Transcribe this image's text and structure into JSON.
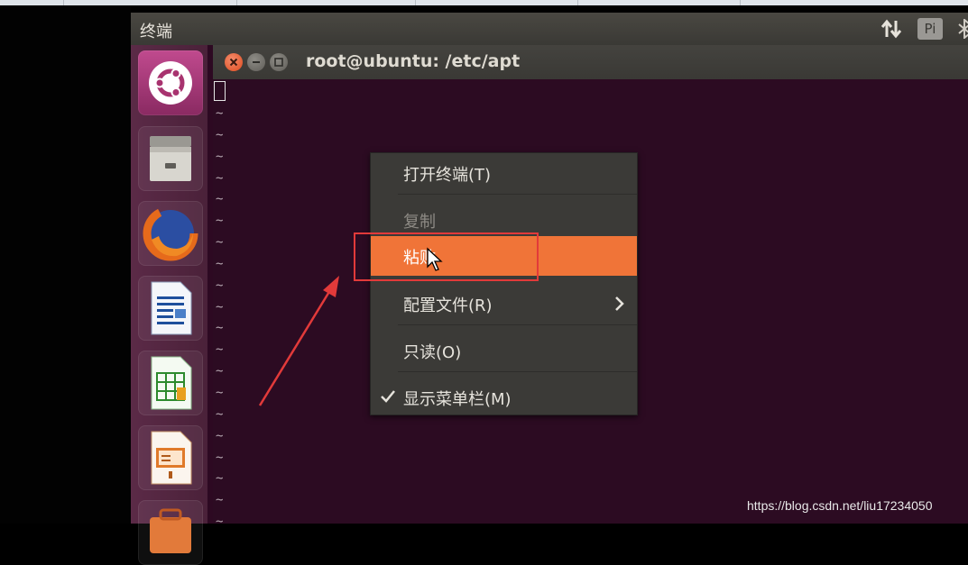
{
  "top_panel": {
    "title": "终端",
    "input_indicator": "Pi",
    "icons": [
      "network-updown-icon",
      "bluetooth-icon"
    ]
  },
  "launcher": {
    "items": [
      {
        "name": "ubuntu-dash-icon"
      },
      {
        "name": "files-cabinet-icon"
      },
      {
        "name": "firefox-icon"
      },
      {
        "name": "libreoffice-writer-icon"
      },
      {
        "name": "libreoffice-calc-icon"
      },
      {
        "name": "libreoffice-impress-icon"
      },
      {
        "name": "software-center-icon"
      }
    ]
  },
  "terminal": {
    "title": "root@ubuntu: /etc/apt",
    "empty_line_marker": "~"
  },
  "context_menu": {
    "items": [
      {
        "label": "打开终端(T)",
        "state": "normal"
      },
      {
        "label": "复制",
        "state": "disabled"
      },
      {
        "label": "粘贴",
        "state": "highlighted"
      },
      {
        "label": "配置文件(R)",
        "state": "normal",
        "submenu": true
      },
      {
        "label": "只读(O)",
        "state": "normal"
      },
      {
        "label": "显示菜单栏(M)",
        "state": "normal",
        "checked": true
      }
    ]
  },
  "annotation": {
    "color": "#e23a3a"
  },
  "watermark": "https://blog.csdn.net/liu17234050",
  "colors": {
    "terminal_bg": "#2c0b22",
    "menu_highlight": "#f07438",
    "launcher_bg": "#5b2a47"
  }
}
